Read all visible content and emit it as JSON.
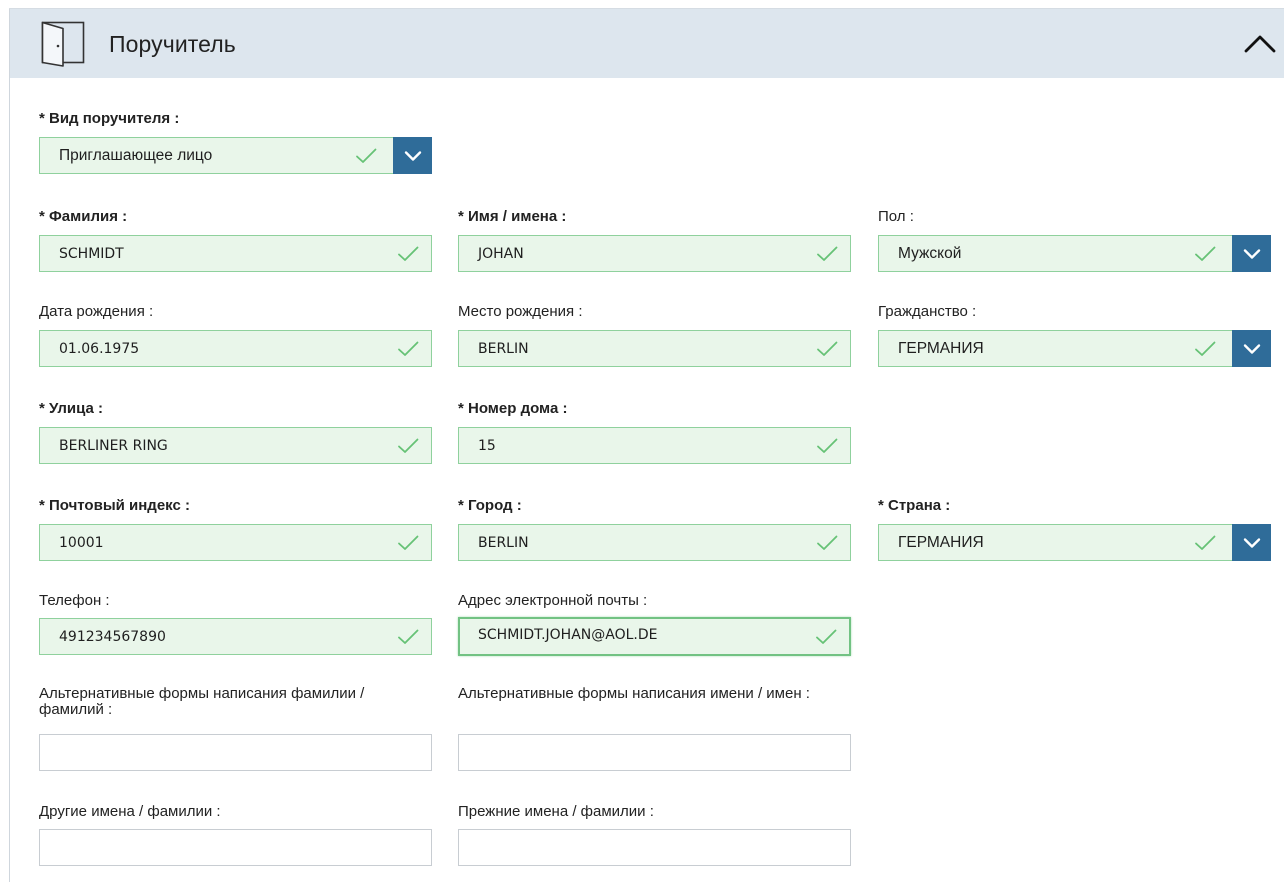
{
  "header": {
    "title": "Поручитель",
    "icon": "door-icon",
    "collapse_icon": "chevron-up-icon"
  },
  "colors": {
    "header_bg": "#dde6ee",
    "valid_border": "#8fd19d",
    "valid_bg": "#e9f6ea",
    "check": "#66c276",
    "dropdown": "#2f6c99"
  },
  "fields": {
    "guarantor_type": {
      "label": "* Вид поручителя :",
      "value": "Приглашающее лицо"
    },
    "surname": {
      "label": "* Фамилия :",
      "value": "SCHMIDT"
    },
    "given_names": {
      "label": "* Имя / имена :",
      "value": "JOHAN"
    },
    "sex": {
      "label": "Пол :",
      "value": "Мужской"
    },
    "birth_date": {
      "label": "Дата рождения :",
      "value": "01.06.1975"
    },
    "birth_place": {
      "label": "Место рождения :",
      "value": "BERLIN"
    },
    "nationality": {
      "label": "Гражданство :",
      "value": "ГЕРМАНИЯ"
    },
    "street": {
      "label": "* Улица :",
      "value": "BERLINER RING"
    },
    "house_number": {
      "label": "* Номер дома :",
      "value": "15"
    },
    "postal_code": {
      "label": "* Почтовый индекс :",
      "value": "10001"
    },
    "city": {
      "label": "* Город :",
      "value": "BERLIN"
    },
    "country": {
      "label": "* Страна :",
      "value": "ГЕРМАНИЯ"
    },
    "phone": {
      "label": "Телефон :",
      "value": "491234567890"
    },
    "email": {
      "label": "Адрес электронной почты :",
      "value": "SCHMIDT.JOHAN@AOL.DE"
    },
    "alt_surnames": {
      "label": "Альтернативные формы написания фамилии / фамилий :",
      "value": ""
    },
    "alt_given_names": {
      "label": "Альтернативные формы написания имени / имен :",
      "value": ""
    },
    "other_names": {
      "label": "Другие имена / фамилии :",
      "value": ""
    },
    "former_names": {
      "label": "Прежние имена / фамилии :",
      "value": ""
    }
  }
}
